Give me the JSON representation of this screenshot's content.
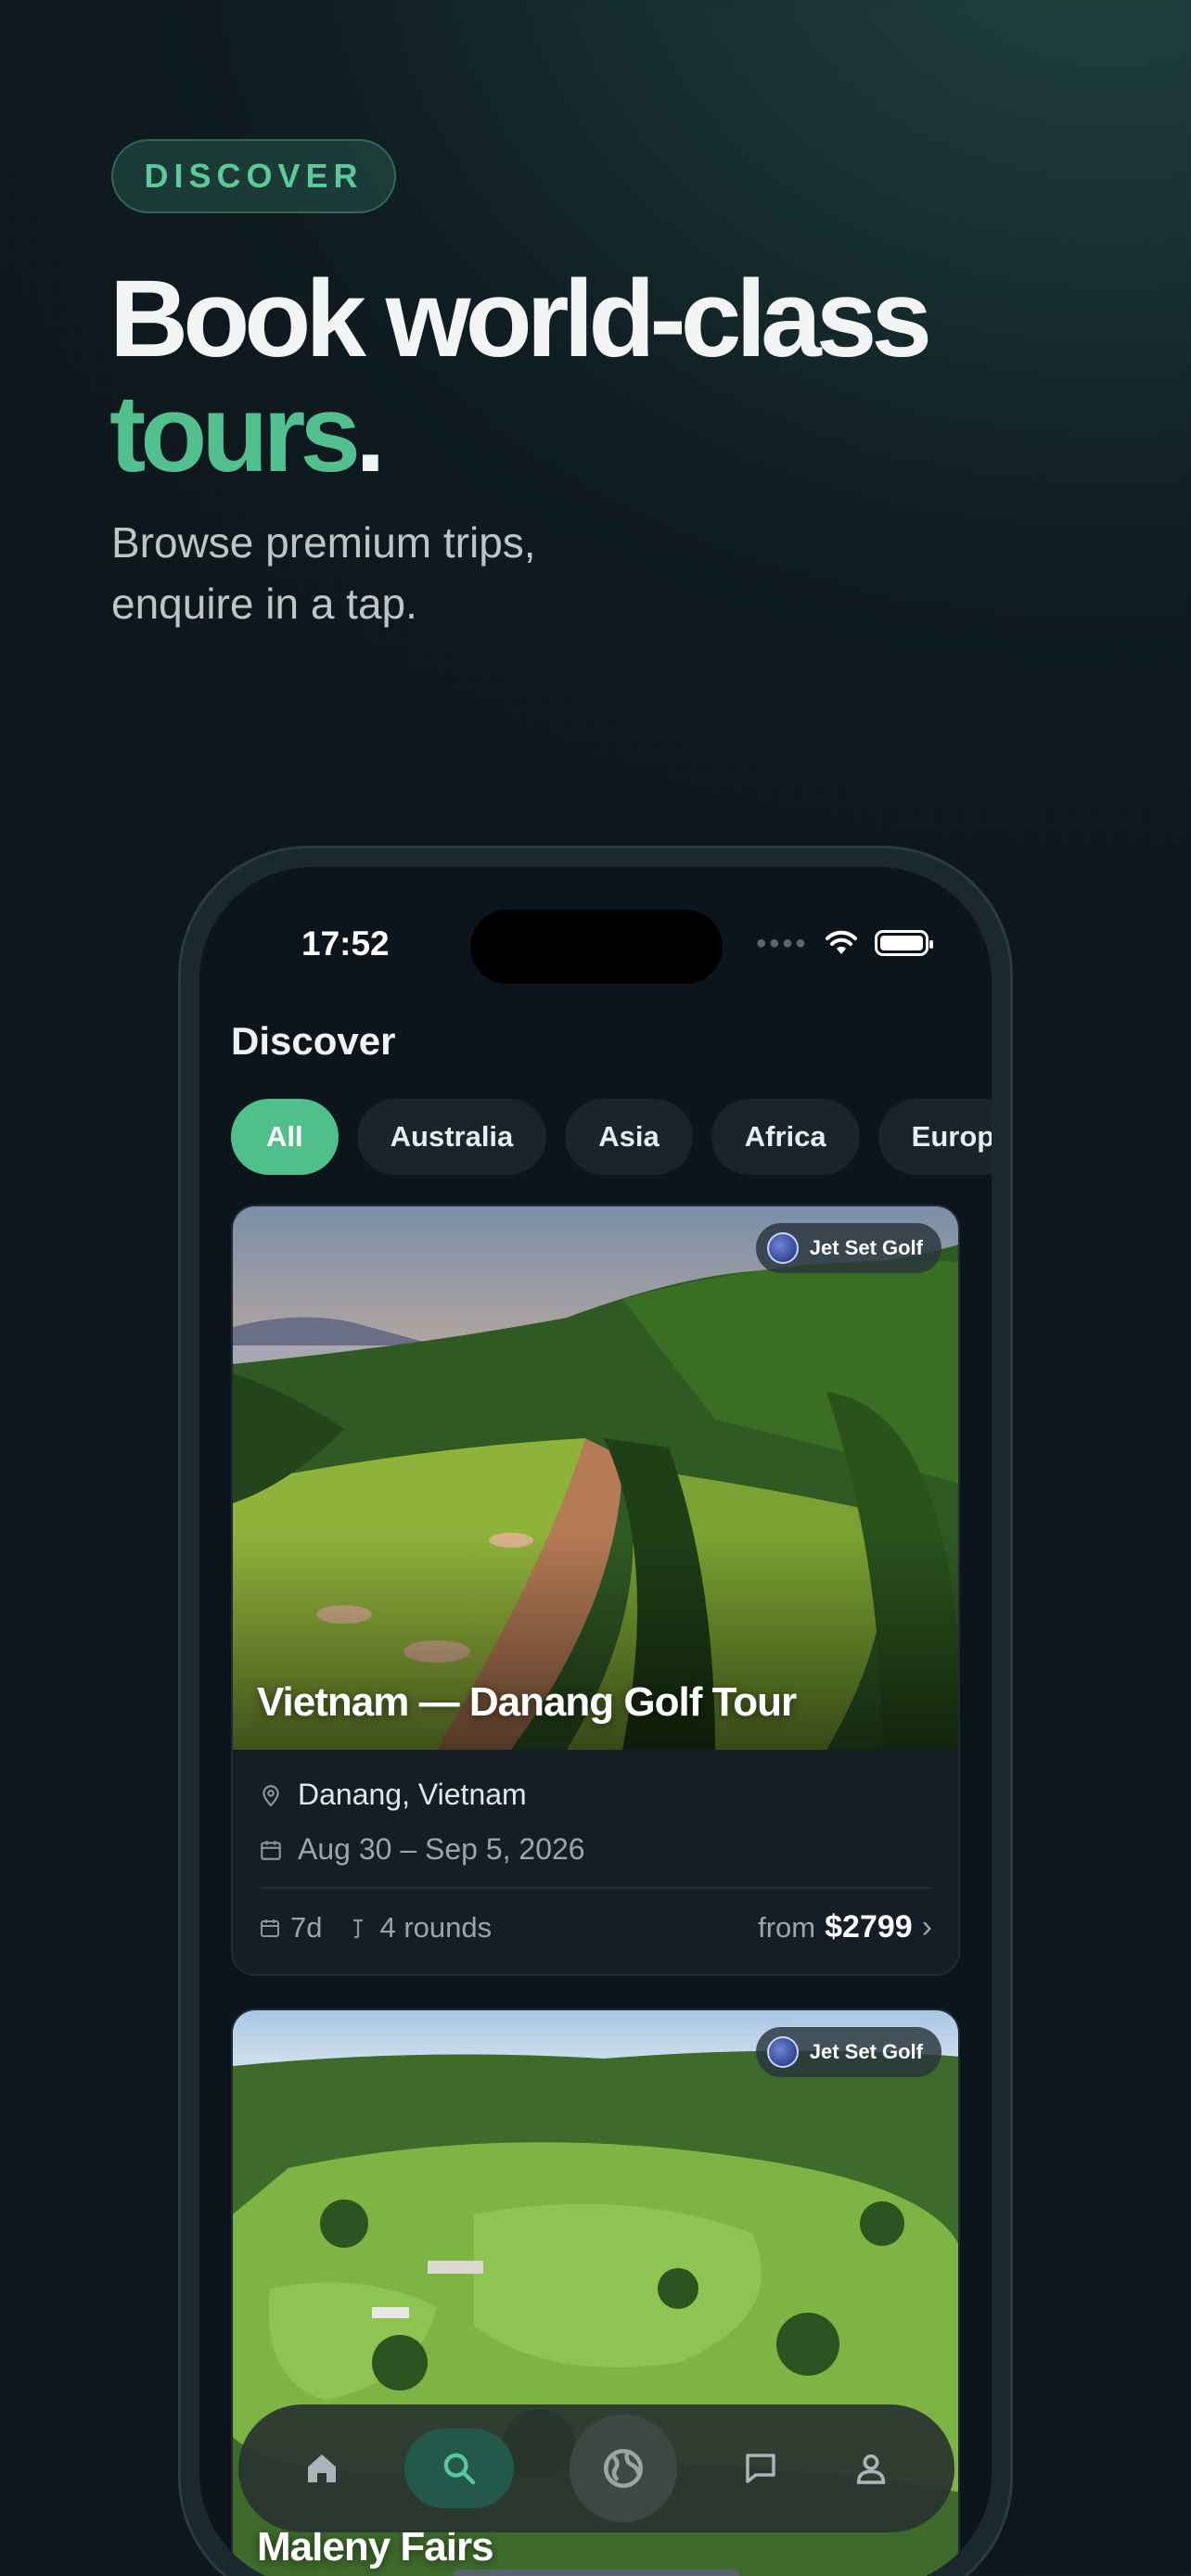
{
  "hero": {
    "eyebrow": "DISCOVER",
    "headline_line1": "Book world-class",
    "headline_accent": "tours",
    "headline_period": ".",
    "subhead_line1": "Browse premium trips,",
    "subhead_line2": "enquire in a tap."
  },
  "status_bar": {
    "time": "17:52"
  },
  "screen": {
    "title": "Discover",
    "filters": [
      {
        "label": "All",
        "active": true
      },
      {
        "label": "Australia",
        "active": false
      },
      {
        "label": "Asia",
        "active": false
      },
      {
        "label": "Africa",
        "active": false
      },
      {
        "label": "Europe",
        "active": false
      }
    ],
    "tours": [
      {
        "operator": "Jet Set Golf",
        "title": "Vietnam — Danang Golf Tour",
        "location": "Danang, Vietnam",
        "dates": "Aug 30 – Sep 5, 2026",
        "duration": "7d",
        "rounds": "4 rounds",
        "price_prefix": "from",
        "price": "$2799"
      },
      {
        "operator": "Jet Set Golf",
        "title": "Maleny Fairs"
      }
    ]
  },
  "tabbar": {
    "items": [
      "home-icon",
      "search-icon",
      "globe-icon",
      "chat-icon",
      "profile-icon"
    ],
    "active": "search-icon"
  },
  "colors": {
    "accent": "#52c08e",
    "background": "#0f1c22",
    "card": "#141e27"
  }
}
